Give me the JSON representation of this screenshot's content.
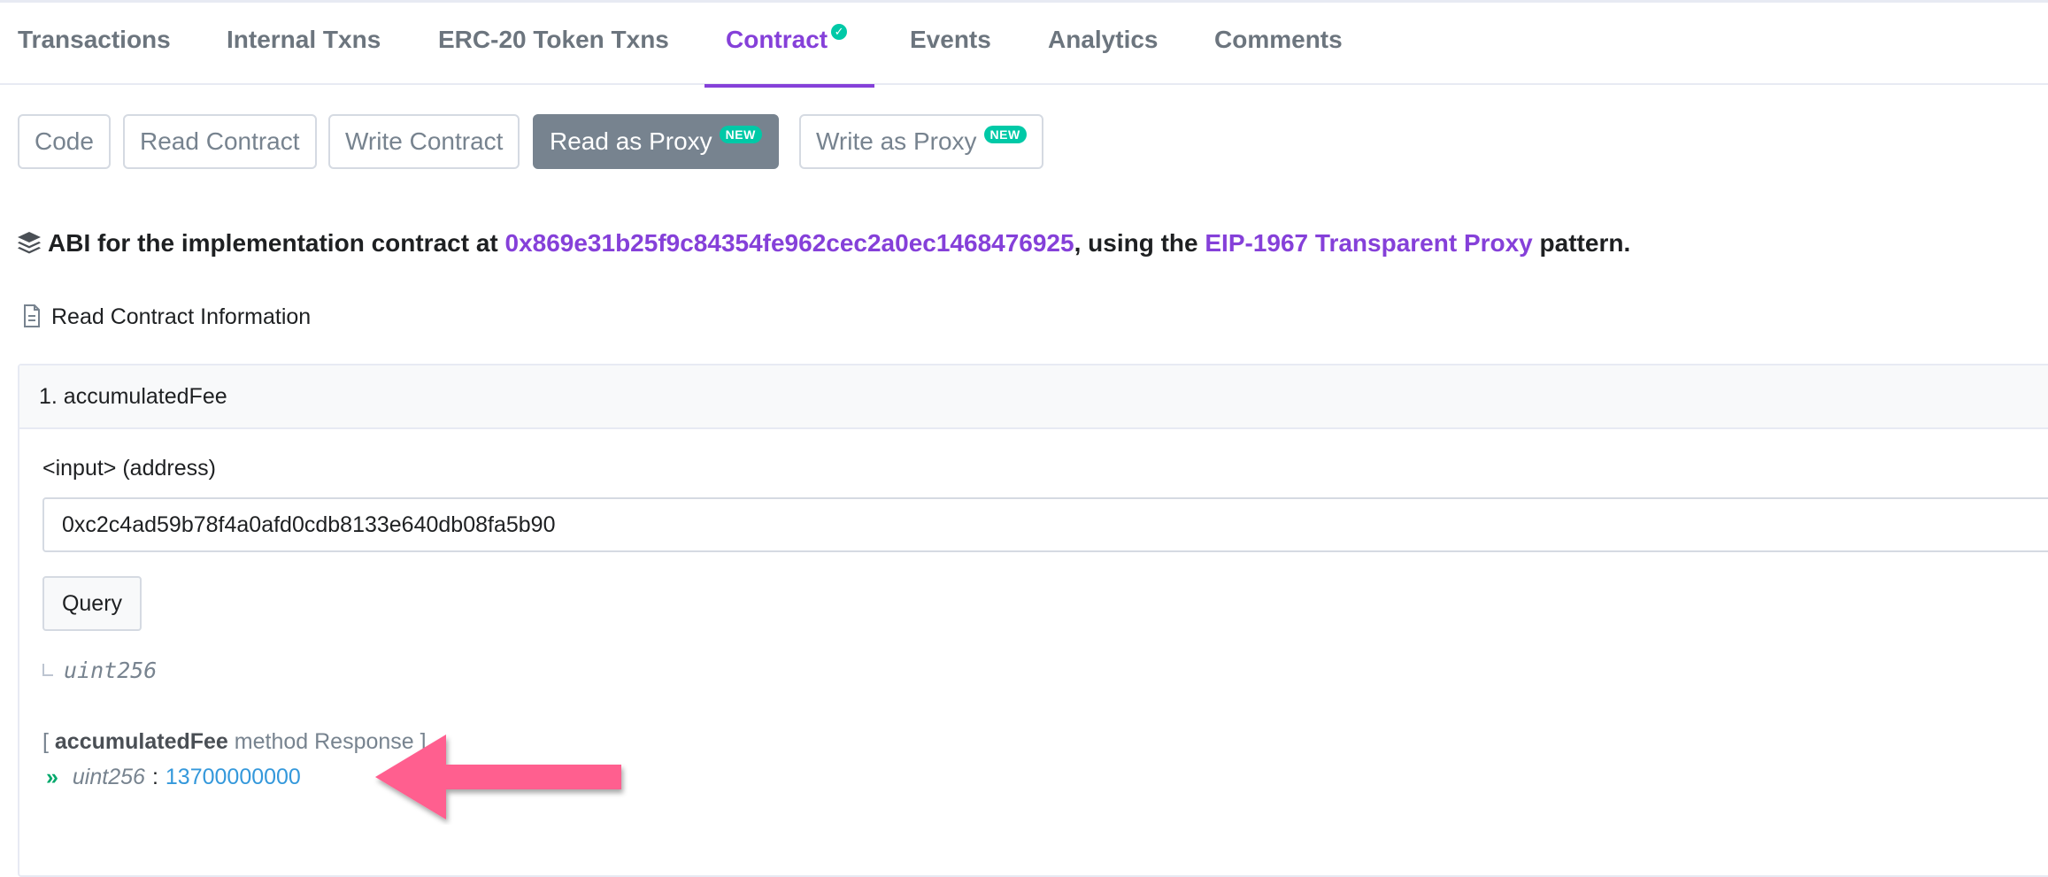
{
  "tabs": [
    {
      "label": "Transactions"
    },
    {
      "label": "Internal Txns"
    },
    {
      "label": "ERC-20 Token Txns"
    },
    {
      "label": "Contract"
    },
    {
      "label": "Events"
    },
    {
      "label": "Analytics"
    },
    {
      "label": "Comments"
    }
  ],
  "active_tab": "Contract",
  "sub_buttons": [
    {
      "label": "Code"
    },
    {
      "label": "Read Contract"
    },
    {
      "label": "Write Contract"
    },
    {
      "label": "Read as Proxy",
      "badge": "NEW"
    },
    {
      "label": "Write as Proxy",
      "badge": "NEW"
    }
  ],
  "active_sub_button": "Read as Proxy",
  "abi": {
    "prefix": "ABI for the implementation contract at ",
    "address": "0x869e31b25f9c84354fe962cec2a0ec1468476925",
    "middle": ", using the ",
    "pattern": "EIP-1967 Transparent Proxy",
    "suffix": " pattern."
  },
  "section_title": "Read Contract Information",
  "method": {
    "header": "1. accumulatedFee",
    "input_label": "<input> (address)",
    "input_value": "0xc2c4ad59b78f4a0afd0cdb8133e640db08fa5b90",
    "query_label": "Query",
    "output_type": "uint256",
    "response_open": "[ ",
    "response_name": "accumulatedFee",
    "response_rest": " method Response ]",
    "response_chevron": "»",
    "response_type": "uint256",
    "response_colon": ":",
    "response_value": "13700000000"
  },
  "colors": {
    "accent_purple": "#8540d9",
    "badge_green": "#00c9a7",
    "value_blue": "#3498db",
    "arrow_pink": "#ff5f8f"
  }
}
